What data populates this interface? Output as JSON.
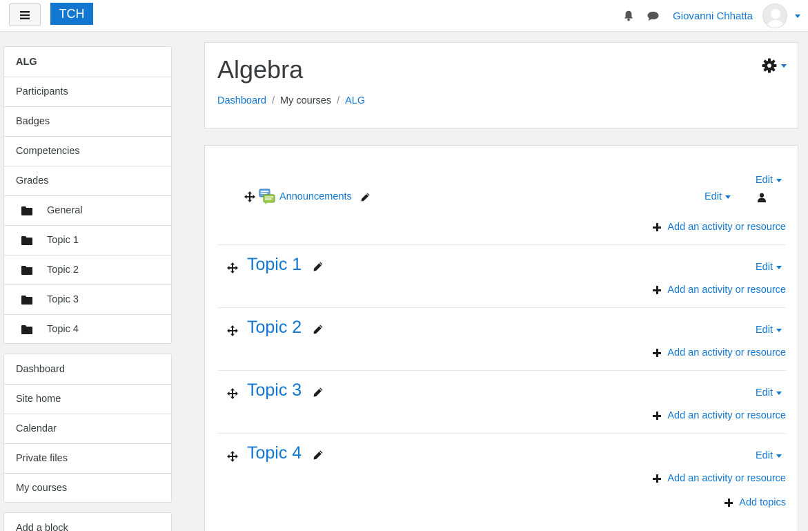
{
  "navbar": {
    "brand": "TCH",
    "user_name": "Giovanni Chhatta",
    "icons": [
      "hamburger-icon",
      "bell-icon",
      "chat-icon",
      "avatar",
      "chevron-down-icon"
    ]
  },
  "drawer": {
    "course_block": [
      {
        "label": "ALG"
      },
      {
        "label": "Participants"
      },
      {
        "label": "Badges"
      },
      {
        "label": "Competencies"
      },
      {
        "label": "Grades"
      },
      {
        "label": "General"
      },
      {
        "label": "Topic 1"
      },
      {
        "label": "Topic 2"
      },
      {
        "label": "Topic 3"
      },
      {
        "label": "Topic 4"
      }
    ],
    "site_block": [
      {
        "label": "Dashboard"
      },
      {
        "label": "Site home"
      },
      {
        "label": "Calendar"
      },
      {
        "label": "Private files"
      },
      {
        "label": "My courses"
      }
    ],
    "add_block": "Add a block"
  },
  "header": {
    "title": "Algebra",
    "breadcrumb": [
      "Dashboard",
      "My courses",
      "ALG"
    ]
  },
  "content": {
    "general": {
      "edit_label": "Edit",
      "activity_name": "Announcements",
      "activity_edit_label": "Edit",
      "add_label": "Add an activity or resource"
    },
    "topics": [
      {
        "title": "Topic 1",
        "edit_label": "Edit",
        "add_label": "Add an activity or resource"
      },
      {
        "title": "Topic 2",
        "edit_label": "Edit",
        "add_label": "Add an activity or resource"
      },
      {
        "title": "Topic 3",
        "edit_label": "Edit",
        "add_label": "Add an activity or resource"
      },
      {
        "title": "Topic 4",
        "edit_label": "Edit",
        "add_label": "Add an activity or resource"
      }
    ],
    "add_topics_label": "Add topics"
  },
  "colors": {
    "link": "#1177d1",
    "brand_bg": "#1177d1",
    "page_bg": "#f2f2f2"
  }
}
